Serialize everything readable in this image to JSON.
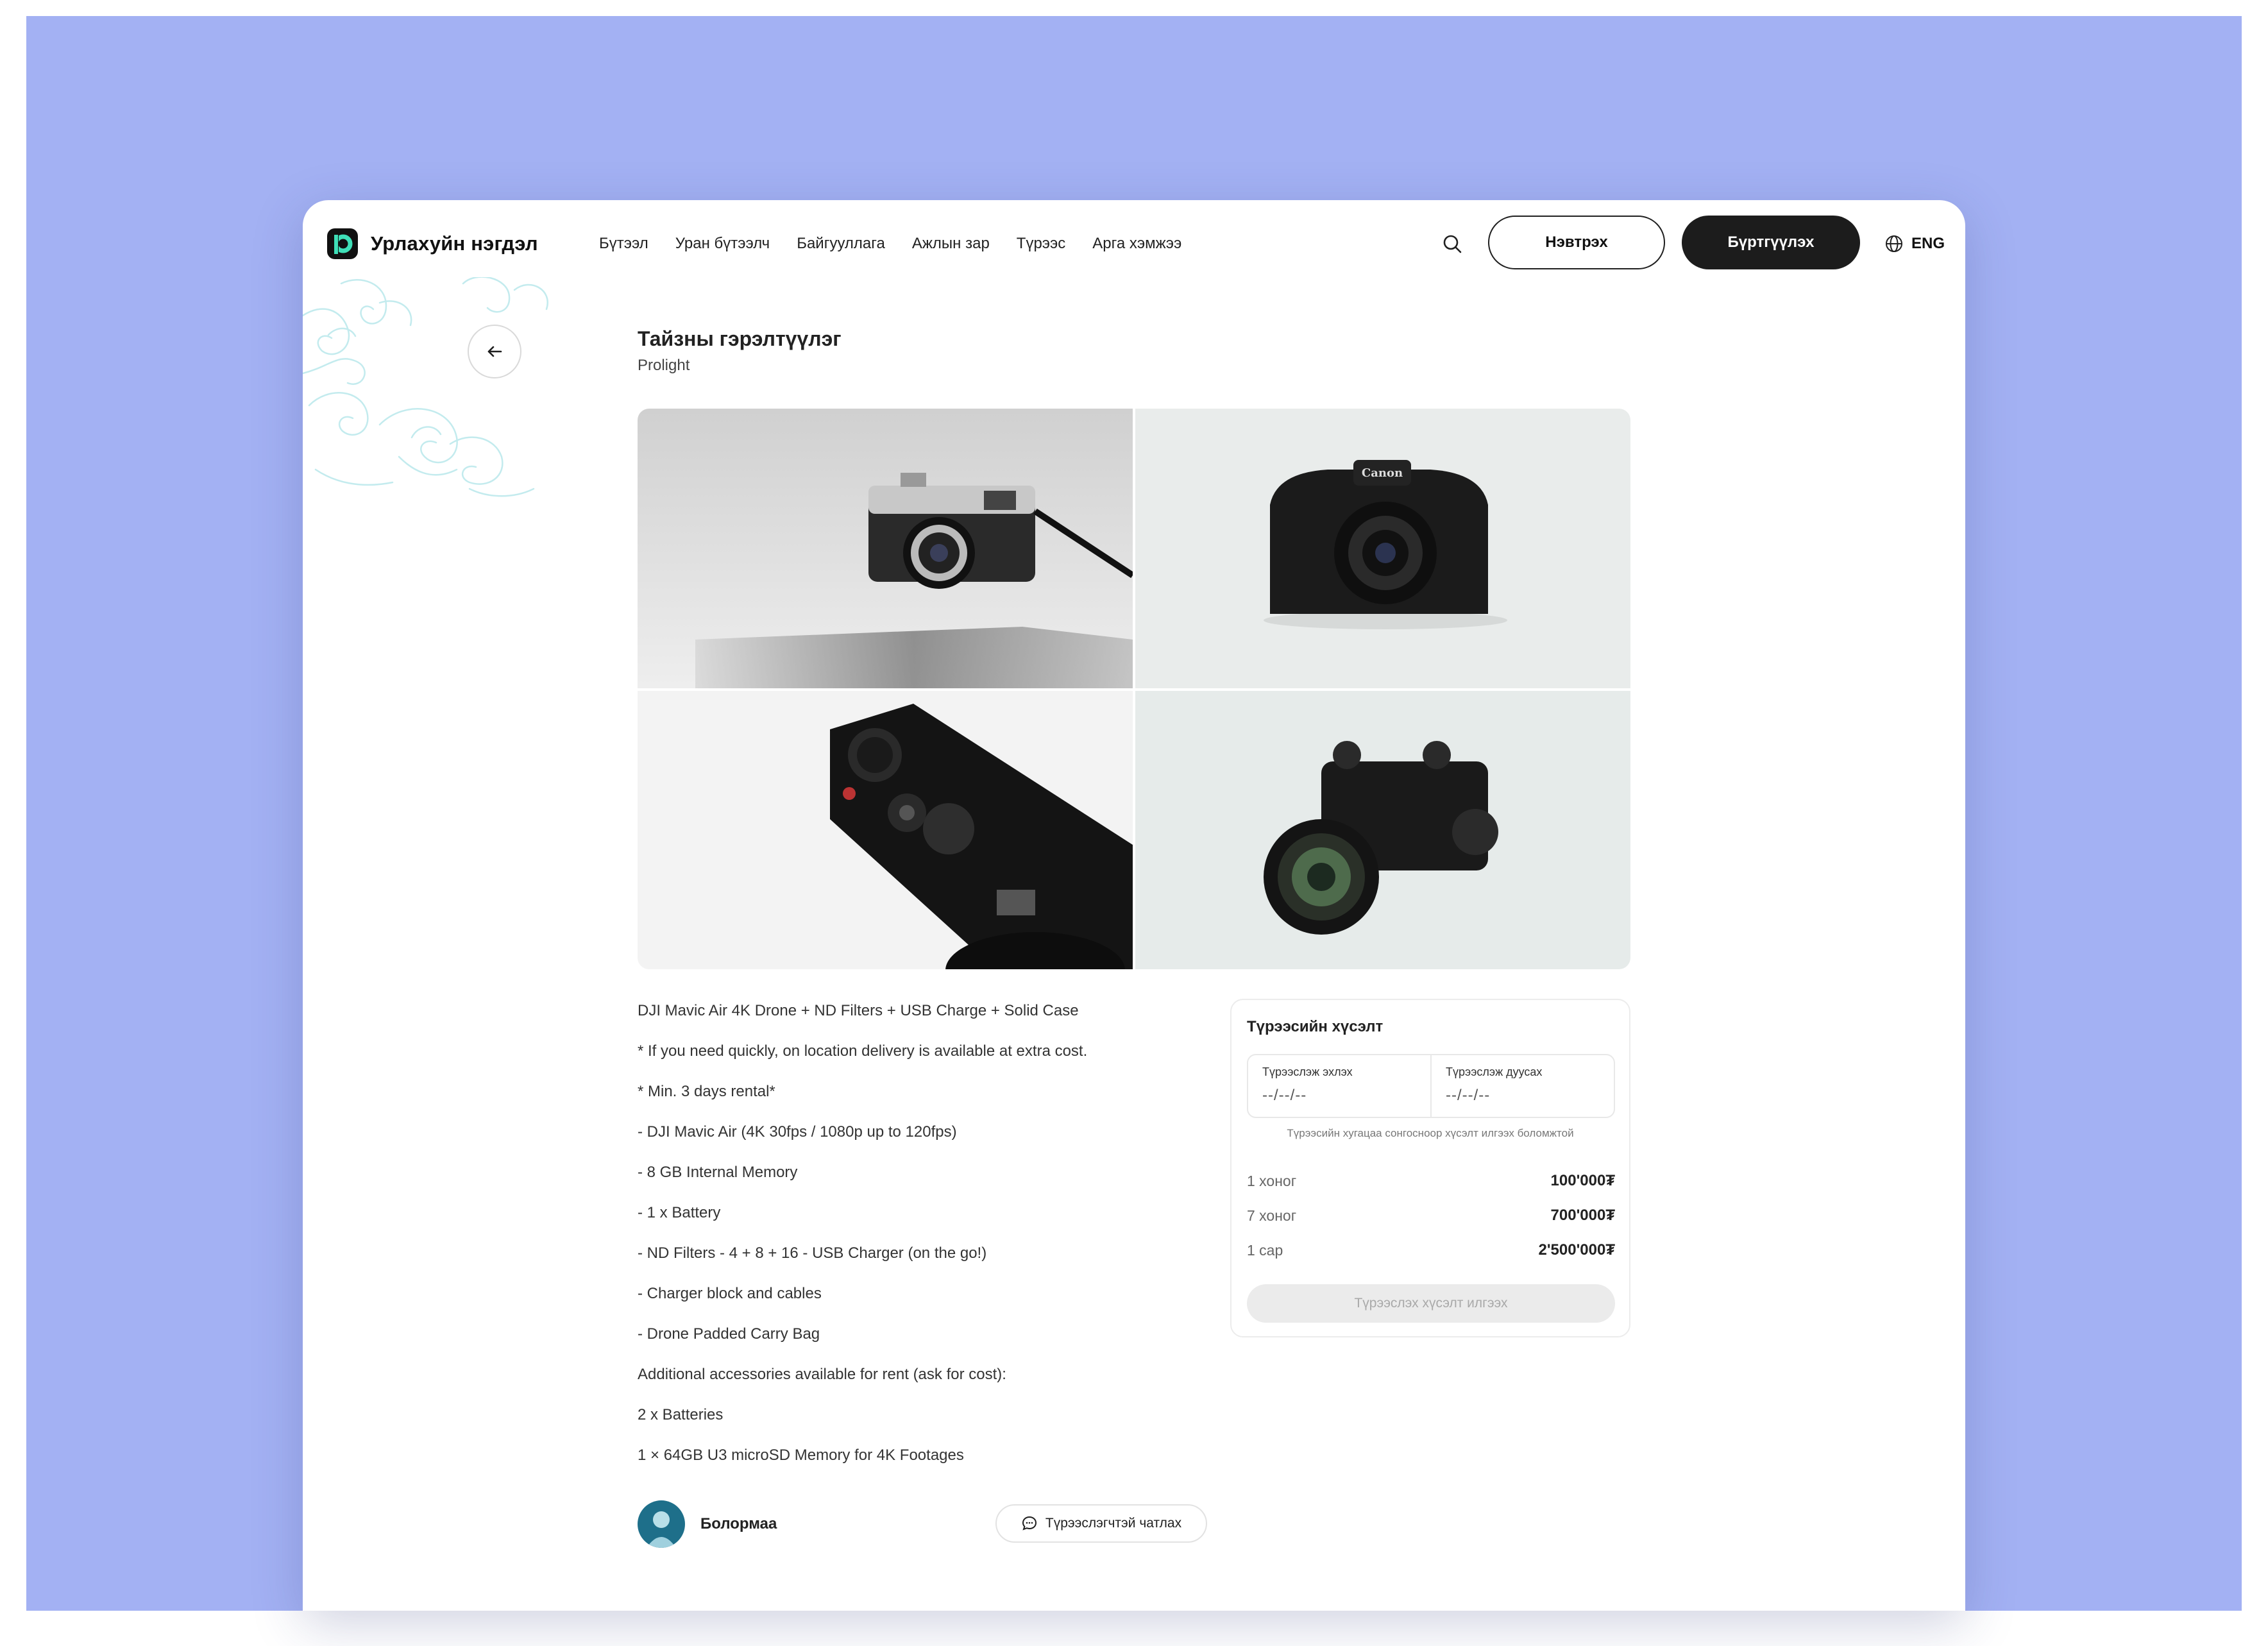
{
  "brand": {
    "name": "Урлахуйн нэгдэл"
  },
  "nav": {
    "items": [
      {
        "label": "Бүтээл"
      },
      {
        "label": "Уран бүтээлч"
      },
      {
        "label": "Байгууллага"
      },
      {
        "label": "Ажлын зар"
      },
      {
        "label": "Түрээс"
      },
      {
        "label": "Арга хэмжээ"
      }
    ]
  },
  "header": {
    "login_label": "Нэвтрэх",
    "register_label": "Бүртгүүлэх",
    "language": "ENG"
  },
  "item": {
    "title": "Тайзны гэрэлтүүлэг",
    "subtitle": "Prolight"
  },
  "description": [
    "DJI Mavic Air 4K Drone + ND Filters + USB Charge + Solid Case",
    "* If you need quickly, on location delivery is available at extra cost.",
    "* Min. 3 days rental*",
    "- DJI Mavic Air (4K 30fps / 1080p up to 120fps)",
    "- 8 GB Internal Memory",
    "- 1 x Battery",
    "- ND Filters - 4 + 8 + 16 - USB Charger (on the go!)",
    "- Charger block and cables",
    "- Drone Padded Carry Bag",
    "Additional accessories available for rent (ask for cost):",
    "2 x Batteries",
    "1 × 64GB U3 microSD Memory for 4K Footages"
  ],
  "owner": {
    "name": "Болормаа",
    "chat_label": "Түрээслэгчтэй чатлах"
  },
  "rental": {
    "title": "Түрээсийн хүсэлт",
    "start_label": "Түрээслэж эхлэх",
    "start_value": "--/--/--",
    "end_label": "Түрээслэж дуусах",
    "end_value": "--/--/--",
    "hint": "Түрээсийн хугацаа сонгосноор хүсэлт илгээх боломжтой",
    "prices": [
      {
        "period": "1 хоног",
        "amount": "100'000₮"
      },
      {
        "period": "7 хоног",
        "amount": "700'000₮"
      },
      {
        "period": "1 сар",
        "amount": "2'500'000₮"
      }
    ],
    "submit_label": "Түрээслэх хүсэлт илгээх"
  },
  "colors": {
    "backdrop": "#a3b1f3",
    "brand_accent": "#3fe0b8",
    "dark_button": "#1c1c1c",
    "decoration": "#bfe9ec"
  },
  "icons": {
    "search": "search-icon",
    "globe": "globe-icon",
    "back": "arrow-left-icon",
    "chat": "chat-bubble-icon"
  }
}
